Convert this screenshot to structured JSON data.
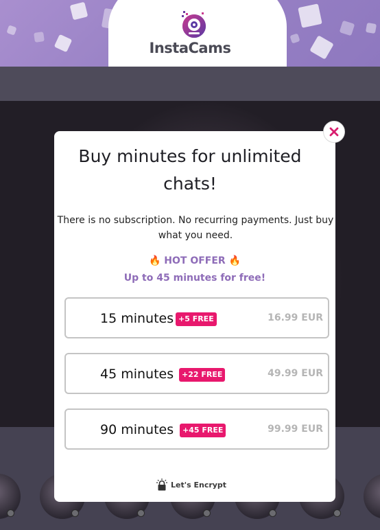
{
  "header": {
    "brand": "InstaCams",
    "logo_icon": "webcam-icon",
    "brand_color": "#8e78bf"
  },
  "modal": {
    "title_line1": "Buy minutes for unlimited",
    "title_line2": "chats!",
    "subtitle": "There is no subscription. No recurring payments. Just buy what you need.",
    "hot_offer": "HOT OFFER",
    "hot_offer_icon": "fire-icon",
    "promo": "Up to 45 minutes for free!",
    "close_icon": "close-icon",
    "options": [
      {
        "minutes": "15 minutes",
        "bonus": "+5 FREE",
        "price": "16.99 EUR"
      },
      {
        "minutes": "45 minutes",
        "bonus": "+22 FREE",
        "price": "49.99 EUR"
      },
      {
        "minutes": "90 minutes",
        "bonus": "+45 FREE",
        "price": "99.99 EUR"
      }
    ],
    "security": "Let's Encrypt",
    "security_icon": "lock-icon"
  },
  "colors": {
    "accent_pink": "#e8186d",
    "accent_purple": "#8e6cb8",
    "muted_price": "#b5b5b5"
  }
}
